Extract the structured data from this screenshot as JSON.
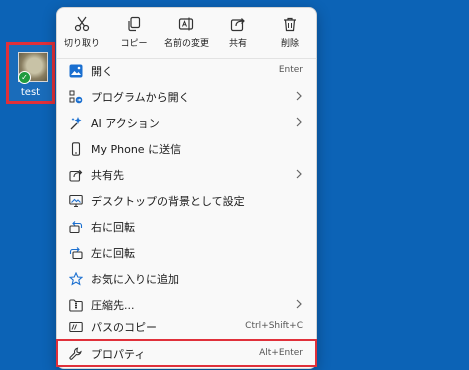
{
  "desktop": {
    "file": {
      "label": "test"
    }
  },
  "menu": {
    "toolbar": [
      {
        "label": "切り取り",
        "icon": "scissors-icon"
      },
      {
        "label": "コピー",
        "icon": "copy-icon"
      },
      {
        "label": "名前の変更",
        "icon": "rename-icon"
      },
      {
        "label": "共有",
        "icon": "share-icon"
      },
      {
        "label": "削除",
        "icon": "trash-icon"
      }
    ],
    "items": [
      {
        "label": "開く",
        "shortcut": "Enter",
        "icon": "image-open-icon"
      },
      {
        "label": "プログラムから開く",
        "submenu": true,
        "icon": "open-with-icon"
      },
      {
        "label": "AI アクション",
        "submenu": true,
        "icon": "ai-sparkle-icon"
      },
      {
        "label": "My Phone に送信",
        "icon": "phone-icon"
      },
      {
        "label": "共有先",
        "submenu": true,
        "icon": "share-to-icon"
      },
      {
        "label": "デスクトップの背景として設定",
        "icon": "desktop-background-icon"
      },
      {
        "label": "右に回転",
        "icon": "rotate-right-icon"
      },
      {
        "label": "左に回転",
        "icon": "rotate-left-icon"
      },
      {
        "label": "お気に入りに追加",
        "icon": "star-icon"
      },
      {
        "label": "圧縮先...",
        "submenu": true,
        "icon": "zip-folder-icon"
      },
      {
        "label": "パスのコピー",
        "shortcut": "Ctrl+Shift+C",
        "icon": "copy-path-icon"
      },
      {
        "label": "プロパティ",
        "shortcut": "Alt+Enter",
        "icon": "wrench-icon"
      }
    ]
  },
  "colors": {
    "desktop": "#0c63b6",
    "highlight": "#e0303a",
    "accent": "#1a6fd0"
  }
}
